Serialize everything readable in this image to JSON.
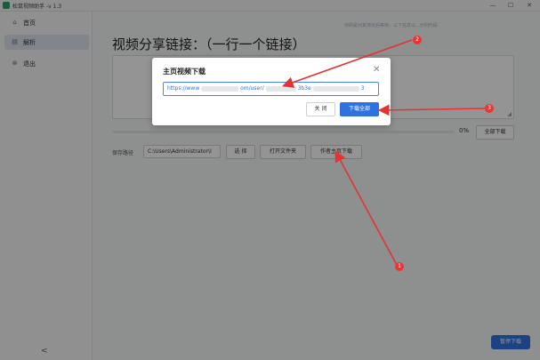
{
  "window": {
    "title": "松鼠视频助手 -v 1.3",
    "min": "—",
    "max": "☐",
    "close": "✕"
  },
  "sidebar": {
    "items": [
      {
        "icon": "⌂",
        "label": "首页"
      },
      {
        "icon": "▤",
        "label": "解析"
      },
      {
        "icon": "⊗",
        "label": "退出"
      }
    ],
    "collapse": "<"
  },
  "main": {
    "title": "视频分享链接：（一行一个链接）",
    "note": "你的是对其地址后等待，以下信息以...示例代码",
    "progress_pct": "0%",
    "progress": 0,
    "download_all": "全部下载",
    "save_path_label": "保存路径",
    "save_path": "C:\\Users\\Administrator\\I",
    "choose": "选 择",
    "open_folder": "打开文件夹",
    "author_download": "作者主页下载",
    "pause": "暂停下载"
  },
  "dialog": {
    "title": "主页视频下载",
    "close": "✕",
    "url_parts": [
      "https://www",
      "om/user/",
      "3b3e",
      "3"
    ],
    "cancel": "关 闭",
    "confirm": "下载全部"
  },
  "annotations": {
    "badge1": "1",
    "badge2": "2",
    "badge3": "3",
    "color": "#e33333"
  },
  "colors": {
    "primary": "#2f72df",
    "sidebar_active": "#dfe6ef",
    "arrow": "#e33333"
  }
}
